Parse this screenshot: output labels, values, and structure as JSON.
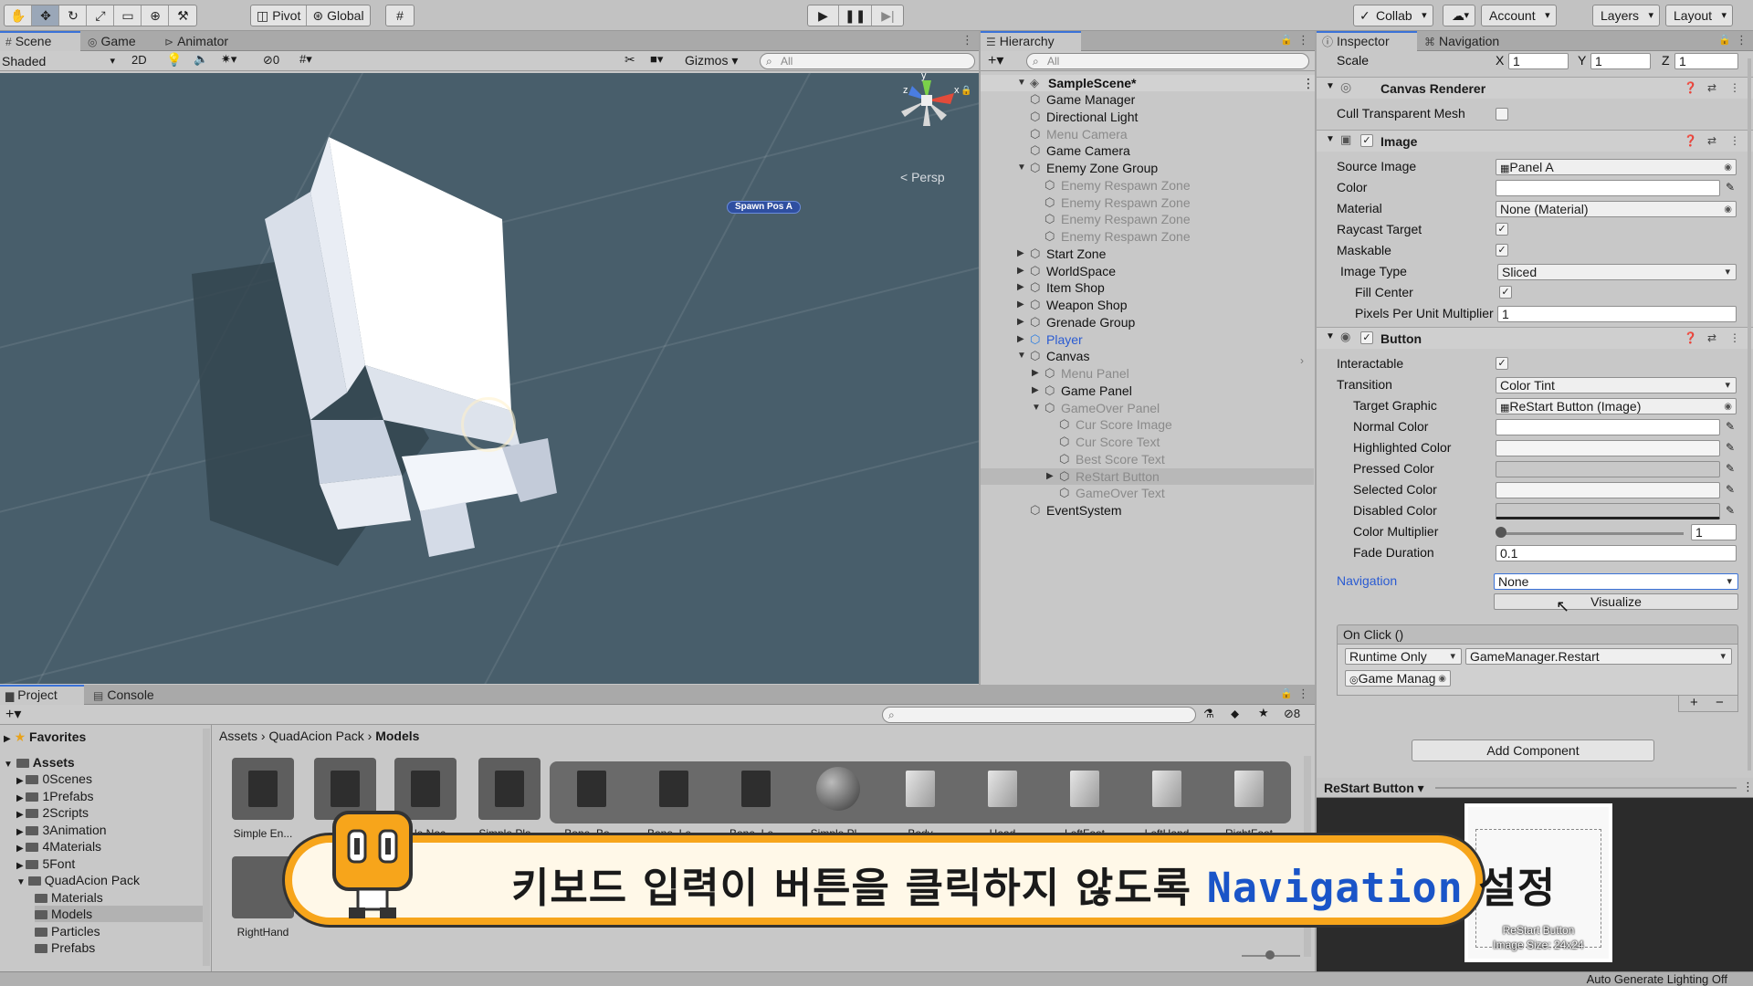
{
  "toolbar": {
    "pivot_label": "Pivot",
    "global_label": "Global",
    "collab_label": "Collab",
    "account_label": "Account",
    "layers_label": "Layers",
    "layout_label": "Layout"
  },
  "scene": {
    "tabs": [
      "Scene",
      "Game",
      "Animator"
    ],
    "shading_mode": "Shaded",
    "mode_2d": "2D",
    "hidden_count": "0",
    "gizmos_label": "Gizmos",
    "search_placeholder": "All",
    "persp_label": "< Persp",
    "spawn_label": "Spawn Pos A",
    "gizmo_axes": {
      "y": "y",
      "z": "z",
      "x": "x"
    }
  },
  "hierarchy": {
    "tab_label": "Hierarchy",
    "search_placeholder": "All",
    "scene_name": "SampleScene*",
    "items": [
      {
        "label": "Game Manager",
        "depth": 1,
        "state": "normal",
        "expand": ""
      },
      {
        "label": "Directional Light",
        "depth": 1,
        "state": "normal",
        "expand": ""
      },
      {
        "label": "Menu Camera",
        "depth": 1,
        "state": "dim",
        "expand": ""
      },
      {
        "label": "Game Camera",
        "depth": 1,
        "state": "normal",
        "expand": ""
      },
      {
        "label": "Enemy Zone Group",
        "depth": 1,
        "state": "normal",
        "expand": "open"
      },
      {
        "label": "Enemy Respawn Zone",
        "depth": 2,
        "state": "dim",
        "expand": ""
      },
      {
        "label": "Enemy Respawn Zone",
        "depth": 2,
        "state": "dim",
        "expand": ""
      },
      {
        "label": "Enemy Respawn Zone",
        "depth": 2,
        "state": "dim",
        "expand": ""
      },
      {
        "label": "Enemy Respawn Zone",
        "depth": 2,
        "state": "dim",
        "expand": ""
      },
      {
        "label": "Start Zone",
        "depth": 1,
        "state": "normal",
        "expand": "closed"
      },
      {
        "label": "WorldSpace",
        "depth": 1,
        "state": "normal",
        "expand": "closed"
      },
      {
        "label": "Item Shop",
        "depth": 1,
        "state": "normal",
        "expand": "closed"
      },
      {
        "label": "Weapon Shop",
        "depth": 1,
        "state": "normal",
        "expand": "closed"
      },
      {
        "label": "Grenade Group",
        "depth": 1,
        "state": "normal",
        "expand": "closed"
      },
      {
        "label": "Player",
        "depth": 1,
        "state": "blue",
        "expand": "closed"
      },
      {
        "label": "Canvas",
        "depth": 1,
        "state": "normal",
        "expand": "open"
      },
      {
        "label": "Menu Panel",
        "depth": 2,
        "state": "dim",
        "expand": "closed"
      },
      {
        "label": "Game Panel",
        "depth": 2,
        "state": "normal",
        "expand": "closed"
      },
      {
        "label": "GameOver Panel",
        "depth": 2,
        "state": "dim",
        "expand": "open"
      },
      {
        "label": "Cur Score Image",
        "depth": 3,
        "state": "dim",
        "expand": ""
      },
      {
        "label": "Cur Score Text",
        "depth": 3,
        "state": "dim",
        "expand": ""
      },
      {
        "label": "Best Score Text",
        "depth": 3,
        "state": "dim",
        "expand": ""
      },
      {
        "label": "ReStart Button",
        "depth": 3,
        "state": "selected",
        "expand": "closed"
      },
      {
        "label": "GameOver Text",
        "depth": 3,
        "state": "dim",
        "expand": ""
      },
      {
        "label": "EventSystem",
        "depth": 1,
        "state": "normal",
        "expand": ""
      }
    ]
  },
  "inspector": {
    "tabs": [
      "Inspector",
      "Navigation"
    ],
    "scale": {
      "label": "Scale",
      "x_label": "X",
      "x": "1",
      "y_label": "Y",
      "y": "1",
      "z_label": "Z",
      "z": "1"
    },
    "canvas_renderer": {
      "title": "Canvas Renderer",
      "cull_label": "Cull Transparent Mesh"
    },
    "image": {
      "title": "Image",
      "source_image_label": "Source Image",
      "source_image": "Panel A",
      "color_label": "Color",
      "material_label": "Material",
      "material": "None (Material)",
      "raycast_label": "Raycast Target",
      "maskable_label": "Maskable",
      "image_type_label": "Image Type",
      "image_type": "Sliced",
      "fill_center_label": "Fill Center",
      "ppu_label": "Pixels Per Unit Multiplier",
      "ppu": "1"
    },
    "button": {
      "title": "Button",
      "interactable_label": "Interactable",
      "transition_label": "Transition",
      "transition": "Color Tint",
      "target_graphic_label": "Target Graphic",
      "target_graphic": "ReStart Button (Image)",
      "normal_label": "Normal Color",
      "highlighted_label": "Highlighted Color",
      "pressed_label": "Pressed Color",
      "selected_label": "Selected Color",
      "disabled_label": "Disabled Color",
      "multiplier_label": "Color Multiplier",
      "multiplier": "1",
      "fade_label": "Fade Duration",
      "fade": "0.1",
      "navigation_label": "Navigation",
      "navigation": "None",
      "visualize_label": "Visualize",
      "onclick_label": "On Click ()",
      "runtime_label": "Runtime Only",
      "function_label": "GameManager.Restart",
      "object_label": "Game Manag",
      "plus_label": "+",
      "minus_label": "−"
    },
    "add_component_label": "Add Component"
  },
  "preview": {
    "title": "ReStart Button",
    "caption1": "ReStart Button",
    "caption2": "Image Size: 24x24"
  },
  "project": {
    "tabs": [
      "Project",
      "Console"
    ],
    "hidden_count": "8",
    "favorites_label": "Favorites",
    "assets_label": "Assets",
    "folders": [
      "0Scenes",
      "1Prefabs",
      "2Scripts",
      "3Animation",
      "4Materials",
      "5Font",
      "QuadAcion Pack",
      "Materials",
      "Models",
      "Particles",
      "Prefabs"
    ],
    "breadcrumb": [
      "Assets",
      "QuadAcion Pack",
      "Models"
    ],
    "assets": [
      "Simple En...",
      "Si...",
      "...le Noc",
      "Simple Pla...",
      "Bone_Bo...",
      "Bone_Le...",
      "Bone_Le...",
      "Simple Pl...",
      "Body",
      "Head",
      "LeftFoot",
      "LeftHand",
      "RightFoot"
    ],
    "asset_row2": [
      "RightHand"
    ]
  },
  "status": {
    "text": "Auto Generate Lighting Off"
  },
  "banner": {
    "text_before": "키보드 입력이 버튼을 클릭하지 않도록 ",
    "text_highlight": "Navigation",
    "text_after": " 설정"
  },
  "colors": {
    "accent_blue": "#2a5bd2",
    "banner_orange": "#f7a51b",
    "scene_bg": "#485e6b"
  }
}
